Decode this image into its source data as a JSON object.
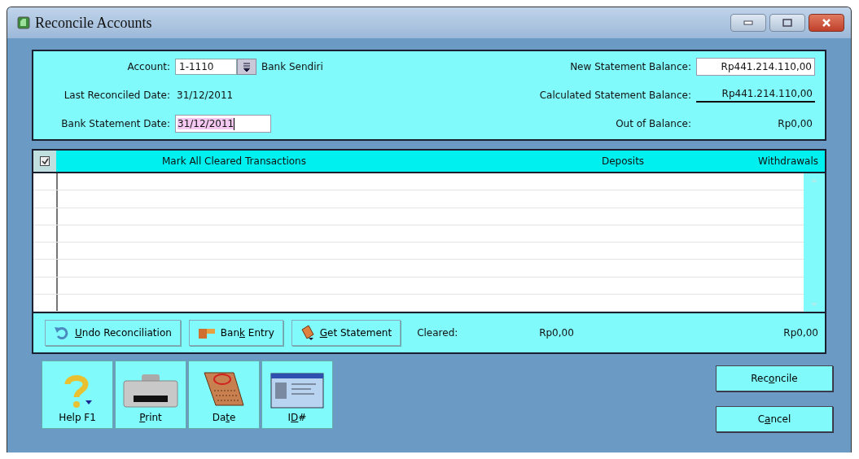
{
  "window": {
    "title": "Reconcile Accounts"
  },
  "header": {
    "account_label": "Account:",
    "account_value": "1-1110",
    "account_name": "Bank Sendiri",
    "last_reconciled_label": "Last Reconciled Date:",
    "last_reconciled_value": "31/12/2011",
    "statement_date_label": "Bank Statement Date:",
    "statement_date_value": "31/12/2011",
    "new_balance_label": "New Statement Balance:",
    "new_balance_value": "Rp441.214.110,00",
    "calculated_label": "Calculated Statement Balance:",
    "calculated_value": "Rp441.214.110,00",
    "out_label": "Out of Balance:",
    "out_value": "Rp0,00"
  },
  "table": {
    "mark_all_checked": true,
    "columns": [
      "Mark All Cleared Transactions",
      "Deposits",
      "Withdrawals"
    ]
  },
  "footer": {
    "buttons": [
      {
        "label": [
          {
            "text": "U",
            "underlined": true
          },
          {
            "text": "ndo Reconciliation",
            "underlined": false
          }
        ],
        "kind": "undo"
      },
      {
        "label": [
          {
            "text": "Ban",
            "underlined": false
          },
          {
            "text": "k",
            "underlined": true
          },
          {
            "text": " Entry",
            "underlined": false
          }
        ],
        "kind": "bank"
      },
      {
        "label": [
          {
            "text": "G",
            "underlined": true
          },
          {
            "text": "et Statement",
            "underlined": false
          }
        ],
        "kind": "statement"
      }
    ],
    "cleared_label": "Cleared:",
    "cleared_deposits": "Rp0,00",
    "cleared_withdrawals": "Rp0,00"
  },
  "tools": [
    {
      "label": [
        {
          "text": "Help F1",
          "underlined": false
        }
      ],
      "kind": "help"
    },
    {
      "label": [
        {
          "text": "P",
          "underlined": true
        },
        {
          "text": "rint",
          "underlined": false
        }
      ],
      "kind": "print"
    },
    {
      "label": [
        {
          "text": "Da",
          "underlined": false
        },
        {
          "text": "t",
          "underlined": true
        },
        {
          "text": "e",
          "underlined": false
        }
      ],
      "kind": "date"
    },
    {
      "label": [
        {
          "text": "I",
          "underlined": false
        },
        {
          "text": "D",
          "underlined": true
        },
        {
          "text": "#",
          "underlined": false
        }
      ],
      "kind": "id"
    }
  ],
  "actions": [
    {
      "label": [
        {
          "text": "Rec",
          "underlined": false
        },
        {
          "text": "o",
          "underlined": true
        },
        {
          "text": "ncile",
          "underlined": false
        }
      ]
    },
    {
      "label": [
        {
          "text": "C",
          "underlined": false
        },
        {
          "text": "a",
          "underlined": true
        },
        {
          "text": "ncel",
          "underlined": false
        }
      ]
    }
  ]
}
